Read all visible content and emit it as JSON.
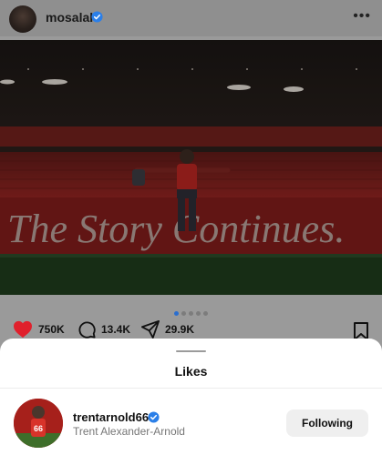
{
  "post": {
    "username": "mosalah",
    "more_icon": "more-horizontal-icon",
    "banner_text": "The Story Continues.",
    "carousel": {
      "count": 5,
      "active": 1
    },
    "likes": "750K",
    "comments": "13.4K",
    "shares": "29.9K"
  },
  "sheet": {
    "title": "Likes",
    "users": [
      {
        "username": "trentarnold66",
        "full_name": "Trent Alexander-Arnold",
        "verified": true,
        "button_label": "Following",
        "jersey_number": "66"
      }
    ]
  },
  "colors": {
    "verified_blue": "#2b7fe8",
    "heart_red": "#e0202c",
    "active_dot": "#2a6ecf"
  }
}
